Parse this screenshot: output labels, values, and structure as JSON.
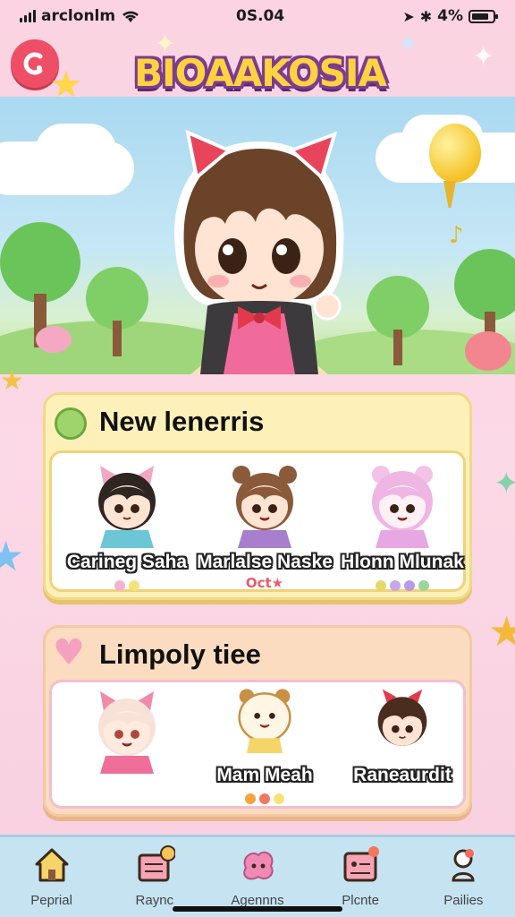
{
  "status_bar": {
    "carrier": "arclonlm",
    "time": "0S.04",
    "battery": "4%"
  },
  "header": {
    "logo_text": "BIOAAKOSIA"
  },
  "new_friends": {
    "title": "New lenerris",
    "friends": [
      {
        "name": "Carineg Saha",
        "dots": [
          "#f5b3d1",
          "#f5e27a"
        ]
      },
      {
        "name": "Marlalse Naske",
        "tag": "Oct★"
      },
      {
        "name": "Hlonn Mlunak",
        "dots": [
          "#e7d86a",
          "#c7a7e8",
          "#b79be6",
          "#9ad59a"
        ]
      }
    ]
  },
  "lovely": {
    "title": "Limpoly tiee",
    "friends": [
      {
        "name": ""
      },
      {
        "name": "Mam Meah",
        "dots": [
          "#f4a53a",
          "#f07a5e",
          "#f5e27a"
        ]
      },
      {
        "name": "Raneaurdit"
      }
    ]
  },
  "nav": {
    "items": [
      {
        "label": "Peprial",
        "icon": "house-icon"
      },
      {
        "label": "Raync",
        "icon": "book-icon"
      },
      {
        "label": "Agennns",
        "icon": "blob-icon"
      },
      {
        "label": "Plcnte",
        "icon": "card-icon"
      },
      {
        "label": "Pailies",
        "icon": "pin-icon"
      }
    ]
  },
  "colors": {
    "accent": "#ef4e67",
    "card_yellow": "#fdf0b8",
    "card_peach": "#fbdcc0",
    "nav_bg": "#c6e3f2"
  }
}
